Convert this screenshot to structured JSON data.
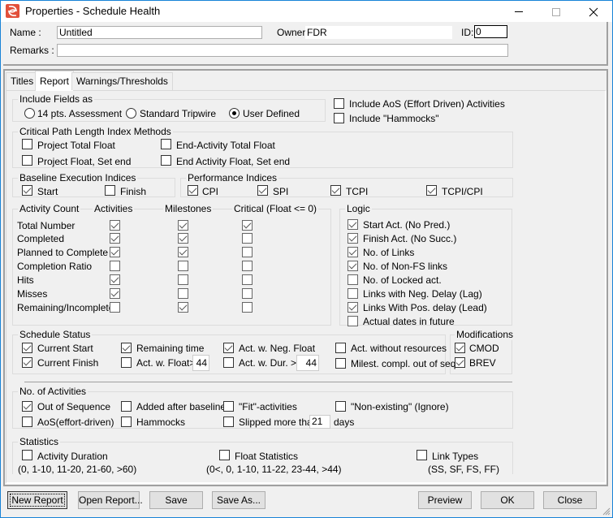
{
  "window": {
    "title": "Properties - Schedule Health",
    "controls": {
      "minimize": "minimize",
      "maximize": "maximize",
      "close": "close"
    }
  },
  "header": {
    "name_label": "Name :",
    "name_value": "Untitled",
    "owner_label": "Owner:",
    "owner_value": "FDR",
    "id_label": "ID:",
    "id_value": "0",
    "remarks_label": "Remarks :",
    "remarks_value": ""
  },
  "tabs": [
    {
      "label": "Titles",
      "active": false
    },
    {
      "label": "Report",
      "active": true
    },
    {
      "label": "Warnings/Thresholds",
      "active": false
    }
  ],
  "include_fields": {
    "title": "Include Fields as",
    "options": [
      {
        "label": "14 pts. Assessment",
        "selected": false
      },
      {
        "label": "Standard Tripwire",
        "selected": false
      },
      {
        "label": "User Defined",
        "selected": true
      }
    ]
  },
  "include_extra": [
    {
      "label": "Include AoS (Effort Driven) Activities",
      "checked": false
    },
    {
      "label": "Include \"Hammocks\"",
      "checked": false
    }
  ],
  "cpli": {
    "title": "Critical Path Length Index Methods",
    "items": [
      {
        "label": "Project Total Float",
        "checked": false
      },
      {
        "label": "End-Activity Total Float",
        "checked": false
      },
      {
        "label": "Project Float, Set end",
        "checked": false
      },
      {
        "label": "End Activity Float, Set end",
        "checked": false
      }
    ]
  },
  "baseline": {
    "title": "Baseline Execution Indices",
    "items": [
      {
        "label": "Start",
        "checked": true
      },
      {
        "label": "Finish",
        "checked": false
      }
    ]
  },
  "performance": {
    "title": "Performance Indices",
    "items": [
      {
        "label": "CPI",
        "checked": true
      },
      {
        "label": "SPI",
        "checked": true
      },
      {
        "label": "TCPI",
        "checked": true
      },
      {
        "label": "TCPI/CPI",
        "checked": true
      }
    ]
  },
  "activity_count": {
    "title": "Activity Count",
    "columns": [
      "Activities",
      "Milestones",
      "Critical (Float <= 0)"
    ],
    "rows": [
      {
        "label": "Total Number",
        "values": [
          true,
          true,
          true
        ]
      },
      {
        "label": "Completed",
        "values": [
          true,
          true,
          false
        ]
      },
      {
        "label": "Planned to Complete",
        "values": [
          true,
          true,
          false
        ]
      },
      {
        "label": "Completion Ratio",
        "values": [
          false,
          false,
          false
        ]
      },
      {
        "label": "Hits",
        "values": [
          true,
          false,
          false
        ]
      },
      {
        "label": "Misses",
        "values": [
          true,
          false,
          false
        ]
      },
      {
        "label": "Remaining/Incomplete",
        "values": [
          false,
          true,
          false
        ]
      }
    ]
  },
  "logic": {
    "title": "Logic",
    "items": [
      {
        "label": "Start Act. (No Pred.)",
        "checked": true
      },
      {
        "label": "Finish Act. (No Succ.)",
        "checked": true
      },
      {
        "label": "No. of Links",
        "checked": true
      },
      {
        "label": "No. of Non-FS links",
        "checked": true
      },
      {
        "label": "No. of Locked act.",
        "checked": false
      },
      {
        "label": "Links with Neg. Delay (Lag)",
        "checked": false
      },
      {
        "label": "Links With Pos. delay (Lead)",
        "checked": true
      },
      {
        "label": "Actual dates in future",
        "checked": false
      }
    ]
  },
  "schedule_status": {
    "title": "Schedule Status",
    "items": [
      {
        "label": "Current Start",
        "checked": true
      },
      {
        "label": "Current Finish",
        "checked": true
      },
      {
        "label": "Remaining time",
        "checked": true
      },
      {
        "label": "Act. w. Float>",
        "checked": false,
        "value": "44"
      },
      {
        "label": "Act. w. Neg. Float",
        "checked": true
      },
      {
        "label": "Act. w. Dur. >",
        "checked": false,
        "value": "44"
      },
      {
        "label": "Act. without resources",
        "checked": false
      },
      {
        "label": "Milest. compl. out of seq.",
        "checked": false
      }
    ]
  },
  "modifications": {
    "title": "Modifications",
    "items": [
      {
        "label": "CMOD",
        "checked": true
      },
      {
        "label": "BREV",
        "checked": true
      }
    ]
  },
  "no_of_activities": {
    "title": "No. of Activities",
    "items": [
      {
        "label": "Out of Sequence",
        "checked": true
      },
      {
        "label": "AoS(effort-driven)",
        "checked": false
      },
      {
        "label": "Added after baseline",
        "checked": false
      },
      {
        "label": "Hammocks",
        "checked": false
      },
      {
        "label": "\"Fit\"-activities",
        "checked": false
      },
      {
        "label": "Slipped more than",
        "checked": false,
        "value": "21",
        "suffix": "days"
      },
      {
        "label": "\"Non-existing\" (Ignore)",
        "checked": false
      }
    ]
  },
  "statistics": {
    "title": "Statistics",
    "items": [
      {
        "label": "Activity Duration",
        "checked": false,
        "ranges": "(0, 1-10, 11-20, 21-60, >60)"
      },
      {
        "label": "Float Statistics",
        "checked": false,
        "ranges": "(0<, 0, 1-10, 11-22, 23-44, >44)"
      },
      {
        "label": "Link Types",
        "checked": false,
        "ranges": "(SS, SF, FS, FF)"
      }
    ]
  },
  "buttons": {
    "new_report": "New Report",
    "open_report": "Open Report...",
    "save": "Save",
    "save_as": "Save As...",
    "preview": "Preview",
    "ok": "OK",
    "close": "Close"
  },
  "colors": {
    "window_border": "#1883d7",
    "app_icon": "#e2503a",
    "dialog_bg": "#f0f0f0"
  }
}
